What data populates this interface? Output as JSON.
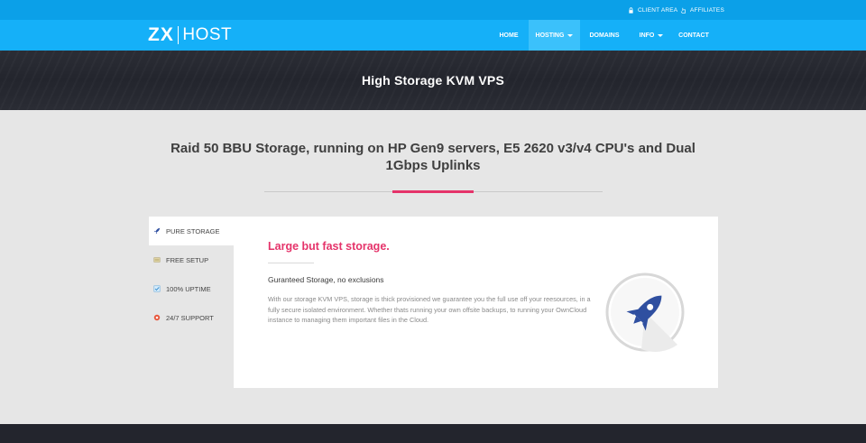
{
  "topbar": {
    "client_area": "CLIENT AREA",
    "affiliates": "AFFILIATES"
  },
  "logo": {
    "part1": "ZX",
    "part2": "HOST"
  },
  "nav": {
    "items": [
      {
        "label": "HOME"
      },
      {
        "label": "HOSTING"
      },
      {
        "label": "DOMAINS"
      },
      {
        "label": "INFO"
      },
      {
        "label": "CONTACT"
      }
    ]
  },
  "hero": {
    "title": "High Storage KVM VPS"
  },
  "section": {
    "headline": "Raid 50 BBU Storage, running on HP Gen9 servers, E5 2620 v3/v4 CPU's and Dual 1Gbps Uplinks"
  },
  "tabs": [
    {
      "label": "PURE STORAGE",
      "icon": "rocket-icon"
    },
    {
      "label": "FREE SETUP",
      "icon": "server-icon"
    },
    {
      "label": "100% UPTIME",
      "icon": "checkbox-icon"
    },
    {
      "label": "24/7 SUPPORT",
      "icon": "support-icon"
    }
  ],
  "panel": {
    "title": "Large but fast storage.",
    "subtitle": "Guranteed Storage, no exclusions",
    "body": "With our storage KVM VPS, storage is thick provisioned we guarantee you the full use off your reesources, in a fully secure isolated environment. Whether thats running your own offsite backups, to running your OwnCloud instance to managing them important files in the Cloud."
  },
  "colors": {
    "topbar": "#0ba0e8",
    "nav": "#15b0f8",
    "nav_active": "#3bc1fb",
    "hero": "#2b2d35",
    "accent": "#e5336a",
    "rocket": "#2f4fa0"
  }
}
